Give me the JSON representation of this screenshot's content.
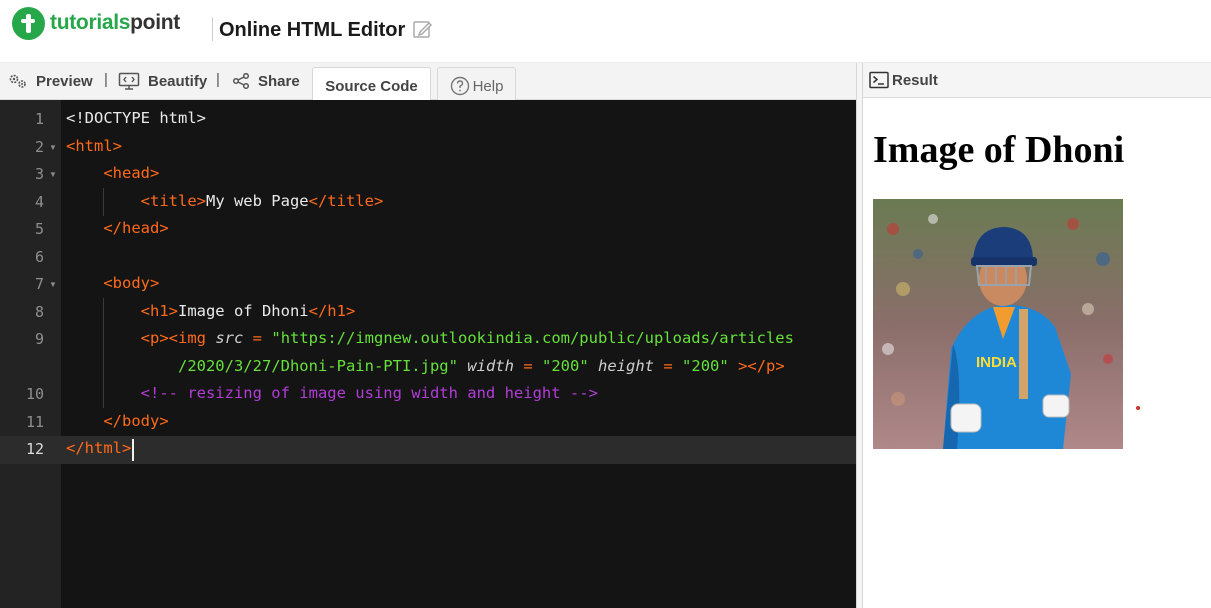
{
  "brand": {
    "name_part1": "tutorials",
    "name_part2": "point"
  },
  "app": {
    "title": "Online HTML Editor"
  },
  "toolbar": {
    "preview_label": "Preview",
    "beautify_label": "Beautify",
    "share_label": "Share",
    "pipe": "|",
    "tabs": [
      {
        "label": "Source Code",
        "active": true
      },
      {
        "label": "Help",
        "active": false
      }
    ]
  },
  "editor": {
    "active_line": 12,
    "line_numbers": [
      "1",
      "2",
      "3",
      "4",
      "5",
      "6",
      "7",
      "8",
      "9",
      "10",
      "11",
      "12"
    ],
    "lines": {
      "l1": "<!DOCTYPE html>",
      "l2_tag": "<html>",
      "l3_tag": "<head>",
      "l4_open": "<title>",
      "l4_text": "My web Page",
      "l4_close": "</title>",
      "l5_tag": "</head>",
      "l7_tag": "<body>",
      "l8_open": "<h1>",
      "l8_text": "Image of Dhoni",
      "l8_close": "</h1>",
      "l9_p": "<p>",
      "l9_img": "<img",
      "l9_src_attr": "src",
      "l9_eq": "=",
      "l9_src_val": "\"https://imgnew.outlookindia.com/public/uploads/articles",
      "l9b_src_val": "/2020/3/27/Dhoni-Pain-PTI.jpg\"",
      "l9b_width_attr": "width",
      "l9b_width_val": "\"200\"",
      "l9b_height_attr": "height",
      "l9b_height_val": "\"200\"",
      "l9b_close": "></p>",
      "l10_comment": "<!-- resizing of image using width and height -->",
      "l11_tag": "</body>",
      "l12_tag": "</html>"
    }
  },
  "result": {
    "label": "Result",
    "h1": "Image of Dhoni",
    "image_alt": "Photo of a cricketer in a blue India jersey and helmet"
  },
  "colors": {
    "brand_green": "#26a74a",
    "editor_bg": "#141414",
    "tag": "#ff6a1a",
    "string": "#66e03a",
    "comment": "#b23cd8"
  }
}
